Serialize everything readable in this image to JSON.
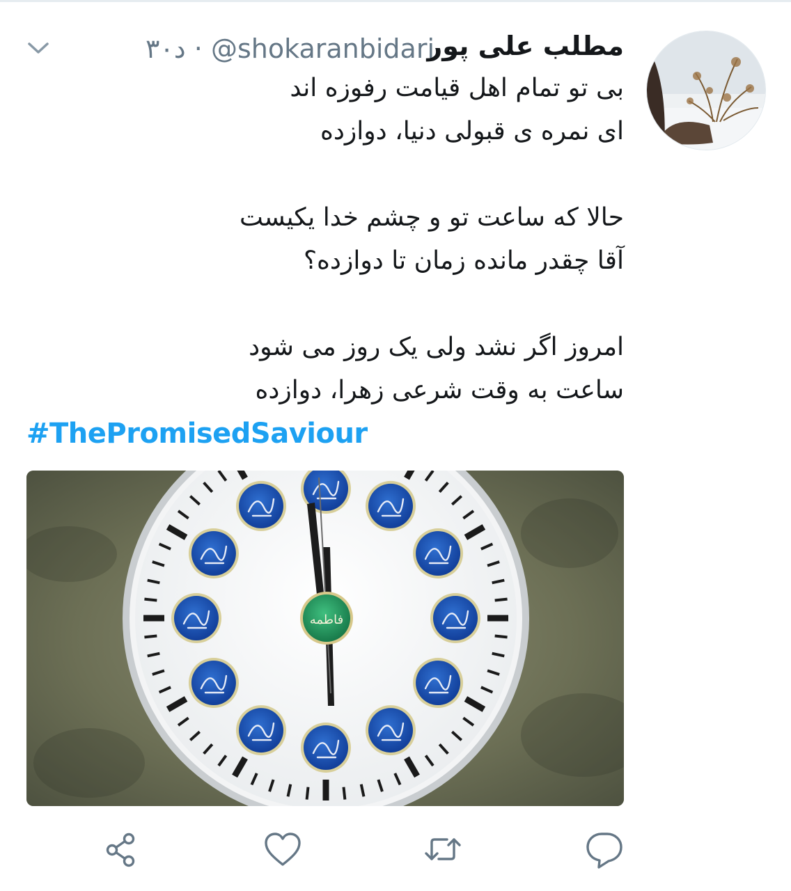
{
  "tweet": {
    "author_name": "مطلب علی پور",
    "handle": "@shokaranbidari",
    "separator": "·",
    "time": "۳۰د",
    "lines": [
      "بی تو تمام اهل قیامت رفوزه اند",
      "ای نمره ی قبولی دنیا، دوازده",
      "",
      "حالا که ساعت تو و چشم خدا یکیست",
      "آقا چقدر مانده زمان تا دوازده؟",
      "",
      "امروز اگر نشد ولی یک روز می شود",
      "ساعت به وقت شرعی زهرا، دوازده"
    ],
    "hashtag": "#ThePromisedSaviour",
    "media": {
      "kind": "clock-image",
      "center_label": "فاطمه"
    }
  },
  "actions": [
    {
      "name": "share-icon"
    },
    {
      "name": "like-icon"
    },
    {
      "name": "retweet-icon"
    },
    {
      "name": "reply-icon"
    }
  ],
  "icons": {
    "menu": "chevron-down-icon"
  },
  "colors": {
    "text": "#14171a",
    "secondary": "#657786",
    "link": "#1da1f2",
    "icon": "#657786"
  }
}
